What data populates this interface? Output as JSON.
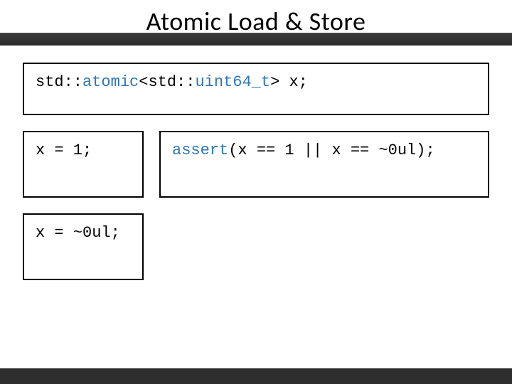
{
  "slide": {
    "title": "Atomic Load & Store"
  },
  "code": {
    "decl": {
      "ns1": "std::",
      "atomic": "atomic",
      "open": "<",
      "ns2": "std::",
      "type": "uint64_t",
      "close": ">",
      "var": " x;"
    },
    "assign1": "x = 1;",
    "assign2": "x = ~0ul;",
    "assert": {
      "fn": "assert",
      "body": "(x == 1 || x == ~0ul);"
    }
  }
}
